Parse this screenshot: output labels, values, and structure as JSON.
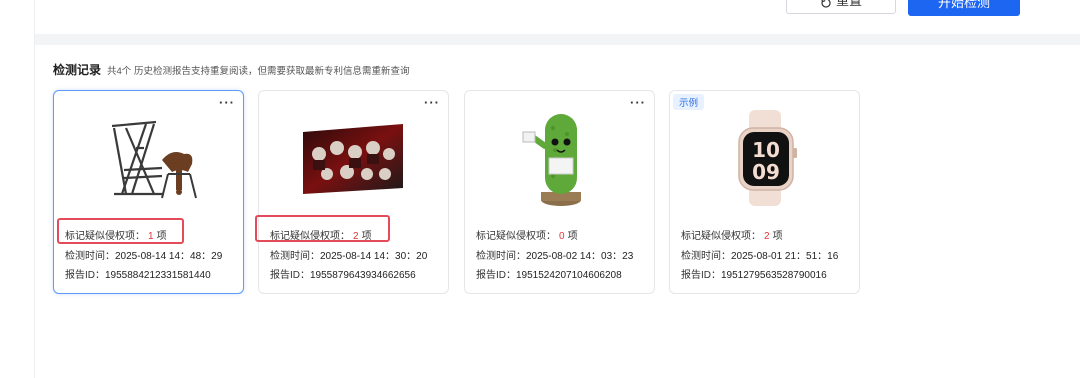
{
  "toolbar": {
    "reset_label": "重置",
    "start_label": "开始检测"
  },
  "records": {
    "title": "检测记录",
    "note": "共4个 历史检测报告支持重复阅读，但需要获取最新专利信息需重新查询",
    "items": [
      {
        "badge": "",
        "more": "···",
        "risk_label": "标记疑似侵权项：",
        "risk_count": "1",
        "risk_unit": "项",
        "time_label": "检测时间：",
        "time_value": "2025-08-14 14：48：29",
        "id_label": "报告ID：",
        "id_value": "1955884212331581440",
        "thumb_icon": "saddle-rack-image"
      },
      {
        "badge": "",
        "more": "···",
        "risk_label": "标记疑似侵权项：",
        "risk_count": "2",
        "risk_unit": "项",
        "time_label": "检测时间：",
        "time_value": "2025-08-14 14：30：20",
        "id_label": "报告ID：",
        "id_value": "1955879643934662656",
        "thumb_icon": "horror-poster-image"
      },
      {
        "badge": "",
        "more": "···",
        "risk_label": "标记疑似侵权项：",
        "risk_count": "0",
        "risk_unit": "项",
        "time_label": "检测时间：",
        "time_value": "2025-08-02 14：03：23",
        "id_label": "报告ID：",
        "id_value": "1951524207104606208",
        "thumb_icon": "crochet-pickle-image"
      },
      {
        "badge": "示例",
        "more": "",
        "risk_label": "标记疑似侵权项：",
        "risk_count": "2",
        "risk_unit": "项",
        "time_label": "检测时间：",
        "time_value": "2025-08-01 21：51：16",
        "id_label": "报告ID：",
        "id_value": "1951279563528790016",
        "thumb_icon": "smartwatch-image"
      }
    ]
  },
  "colors": {
    "primary": "#1d66f2",
    "danger": "#e3343a",
    "highlight_box": "#e34b5a",
    "selected_border": "#5b9cf5"
  }
}
